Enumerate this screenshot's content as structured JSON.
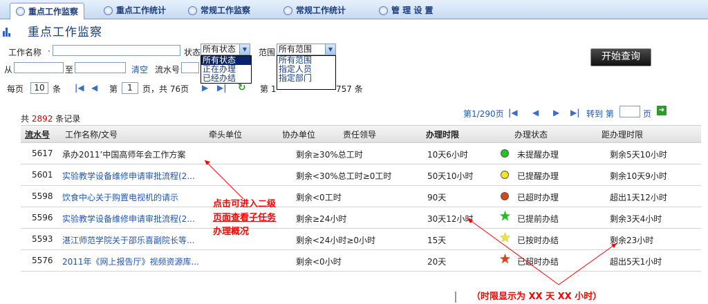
{
  "tabs": [
    {
      "label": "重点工作监察"
    },
    {
      "label": "重点工作统计"
    },
    {
      "label": "常规工作监察"
    },
    {
      "label": "常规工作统计"
    },
    {
      "label": "管 理 设 置"
    }
  ],
  "page_title": "重点工作监察",
  "form": {
    "name_label": "工作名称",
    "status_label": "状态",
    "status_value": "所有状态",
    "status_options": [
      "所有状态",
      "正在办理",
      "已经办结"
    ],
    "range_label": "范围",
    "range_value": "所有范围",
    "range_options": [
      "所有范围",
      "指定人员",
      "指定部门"
    ],
    "from_label": "从",
    "to_label": "至",
    "clear_label": "清空",
    "serial_label": "流水号",
    "search_button": "开始查询"
  },
  "pager": {
    "per_page_label": "每页",
    "per_page_value": "10",
    "per_page_unit": "条",
    "page_prefix": "第",
    "page_value": "1",
    "page_suffix": "页，共 76页",
    "right_prefix": "第 1",
    "right_total": "757 条"
  },
  "list": {
    "total_prefix": "共",
    "total_count": "2892",
    "total_suffix": "条记录",
    "page_info": "第1/290页",
    "goto_label": "转到 第",
    "goto_suffix": "页"
  },
  "columns": [
    "流水号",
    "工作名称/文号",
    "牵头单位",
    "协办单位",
    "责任领导",
    "办理时限",
    "办理状态",
    "距办理时限"
  ],
  "rows": [
    {
      "id": "5617",
      "name": "承办2011’中国高师年会工作方案",
      "time": "剩余≥30%总工时",
      "limit": "10天6小时",
      "status": "未提醒办理",
      "icon": "green-dot",
      "color": "#22c422",
      "remain": "剩余5天10小时"
    },
    {
      "id": "5601",
      "name": "实验教学设备维修申请审批流程(2...",
      "time": "剩余<30%总工时≥0工时",
      "limit": "50天10小时",
      "status": "已提醒办理",
      "icon": "yellow-dot",
      "color": "#f2e32a",
      "remain": "剩余10天9小时"
    },
    {
      "id": "5598",
      "name": "饮食中心关于购置电视机的请示",
      "time": "剩余<0工时",
      "limit": "90天",
      "status": "已超时办理",
      "icon": "red-dot",
      "color": "#d9461c",
      "remain": "超出1天12小时"
    },
    {
      "id": "5596",
      "name": "实验教学设备维修申请审批流程(2...",
      "time": "剩余≥24小时",
      "limit": "30天12小时",
      "status": "已提前办结",
      "icon": "green-star",
      "color": "#18c418",
      "remain": "剩余3天4小时"
    },
    {
      "id": "5593",
      "name": "湛江师范学院关于邵乐喜副院长等...",
      "time": "剩余<24小时≥0小时",
      "limit": "15天",
      "status": "已按时办结",
      "icon": "yellow-star",
      "color": "#f0e62a",
      "remain": "剩余23小时"
    },
    {
      "id": "5576",
      "name": "2011年《网上报告厅》视频资源库...",
      "time": "剩余<0小时",
      "limit": "20天",
      "status": "已超时办结",
      "icon": "red-star",
      "color": "#d9461c",
      "remain": "超出5天1小时"
    }
  ],
  "annotations": {
    "note1_line1": "点击可进入二级",
    "note1_line2": "页面查看子任务",
    "note1_line3": "办理概况",
    "note2": "（时限显示为 XX 天 XX 小时）"
  }
}
